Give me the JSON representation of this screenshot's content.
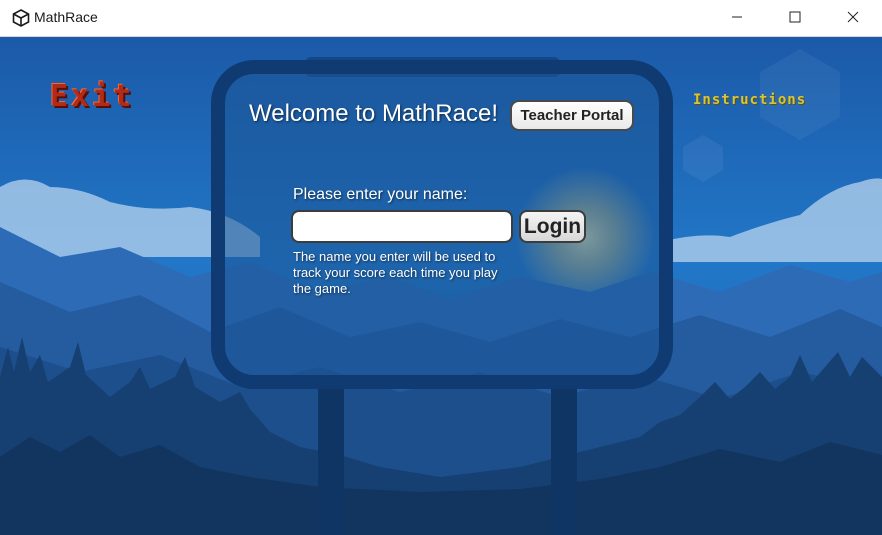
{
  "window": {
    "title": "MathRace",
    "icon": "unity-logo-icon",
    "controls": [
      "minimize-icon",
      "maximize-icon",
      "close-icon"
    ]
  },
  "game": {
    "exit_label": "Exit",
    "instructions_label": "Instructions",
    "welcome_text": "Welcome to MathRace!",
    "teacher_portal_label": "Teacher Portal",
    "name_prompt": "Please enter your name:",
    "name_input": {
      "value": "",
      "placeholder": ""
    },
    "login_label": "Login",
    "helper_text": "The name you enter will be used to track your score each time you play the game."
  },
  "colors": {
    "sky_top": "#1c5fb0",
    "sky_bottom": "#1f77c7",
    "exit_red": "#b22a18",
    "instructions_yellow": "#d8c43a",
    "sign_frame": "#0f3a72"
  }
}
